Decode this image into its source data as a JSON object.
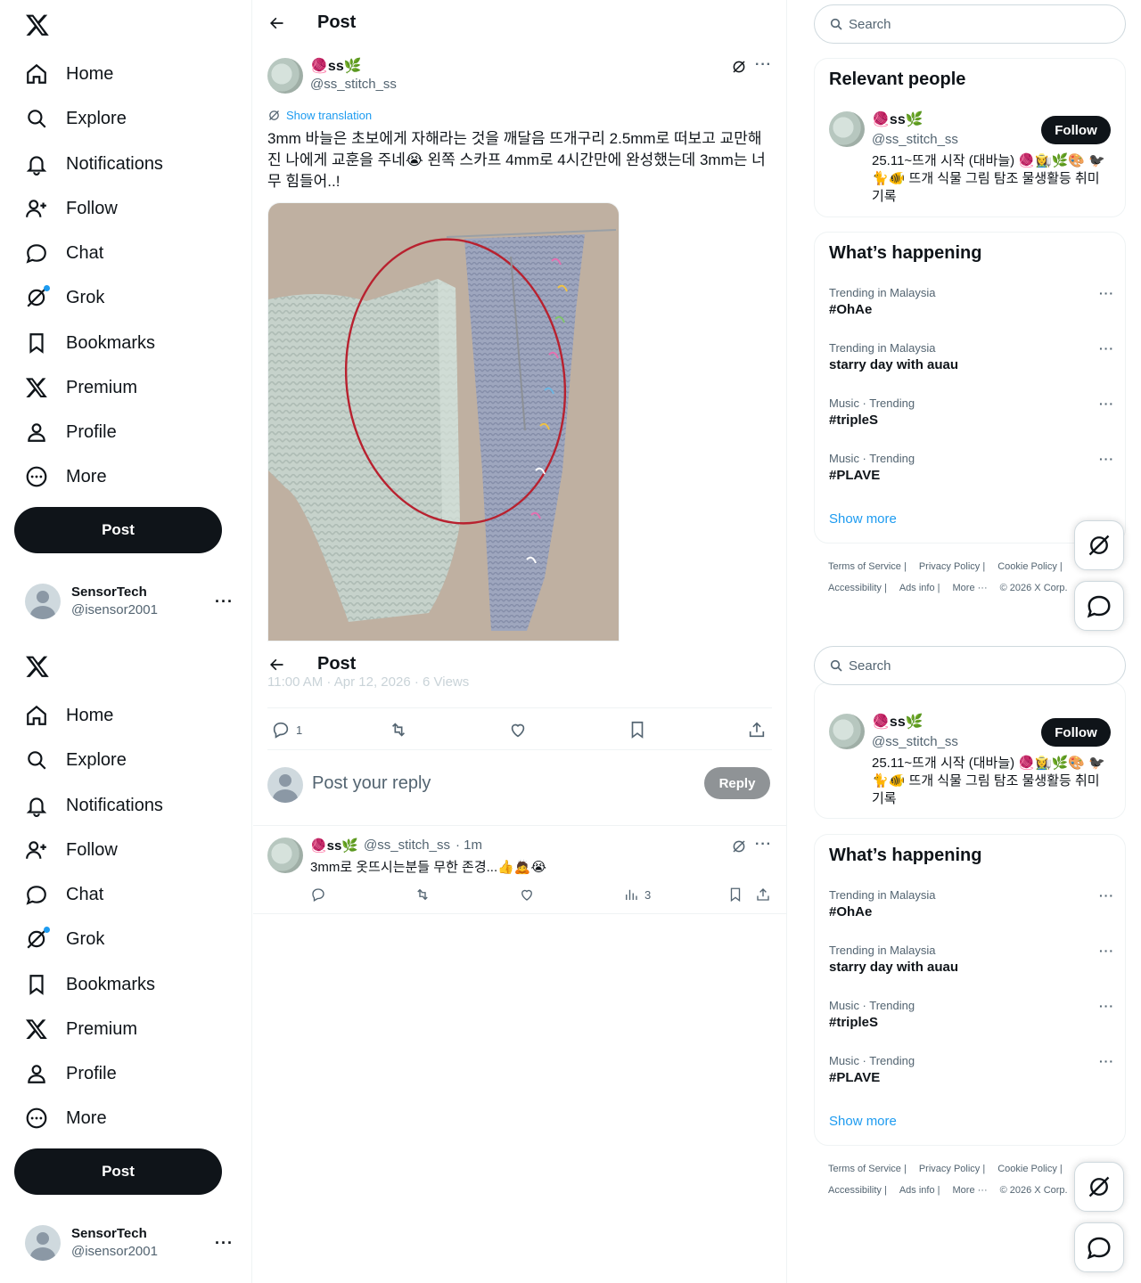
{
  "nav": {
    "items": [
      {
        "label": "Home",
        "icon": "home-icon"
      },
      {
        "label": "Explore",
        "icon": "search-icon"
      },
      {
        "label": "Notifications",
        "icon": "bell-icon"
      },
      {
        "label": "Follow",
        "icon": "add-person-icon"
      },
      {
        "label": "Chat",
        "icon": "chat-bubble-icon"
      },
      {
        "label": "Grok",
        "icon": "grok-icon"
      },
      {
        "label": "Bookmarks",
        "icon": "bookmark-icon"
      },
      {
        "label": "Premium",
        "icon": "x-logo-icon"
      },
      {
        "label": "Profile",
        "icon": "person-icon"
      },
      {
        "label": "More",
        "icon": "more-circle-icon"
      }
    ],
    "post_label": "Post"
  },
  "account": {
    "name": "SensorTech",
    "handle": "@isensor2001"
  },
  "topbar": {
    "title": "Post"
  },
  "post": {
    "display_name": "🧶ss🌿",
    "handle": "@ss_stitch_ss",
    "translate": "Show translation",
    "text": "3mm 바늘은 초보에게 자해라는 것을 깨달음 뜨개구리 2.5mm로 떠보고 교만해진 나에게 교훈을 주네😭 왼쪽 스카프 4mm로 4시간만에 완성했는데 3mm는 너무 힘들어..!",
    "meta": "11:00 AM · Apr 12, 2026 · 6 Views",
    "reply_count": "1"
  },
  "reply_box": {
    "placeholder": "Post your reply",
    "button": "Reply"
  },
  "comment": {
    "display_name": "🧶ss🌿",
    "handle": "@ss_stitch_ss",
    "time": "· 1m",
    "text": "3mm로 옷뜨시는분들 무한 존경...👍🙇😭",
    "views": "3"
  },
  "search": {
    "placeholder": "Search"
  },
  "relevant": {
    "title": "Relevant people",
    "name": "🧶ss🌿",
    "handle": "@ss_stitch_ss",
    "follow": "Follow",
    "bio": "25.11~뜨개 시작 (대바늘) 🧶👩‍🌾🌿🎨 🐦‍⬛🐈🐠 뜨개 식물 그림 탐조 물생활등 취미 기록"
  },
  "happening": {
    "title": "What’s happening",
    "trends": [
      {
        "context": "Trending in Malaysia",
        "topic": "#OhAe"
      },
      {
        "context": "Trending in Malaysia",
        "topic": "starry day with auau"
      },
      {
        "context": "Music · Trending",
        "topic": "#tripleS"
      },
      {
        "context": "Music · Trending",
        "topic": "#PLAVE"
      }
    ],
    "show_more": "Show more"
  },
  "footer": {
    "links": [
      "Terms of Service |",
      "Privacy Policy |",
      "Cookie Policy |"
    ],
    "links2": [
      "Accessibility |",
      "Ads info |",
      "More ···",
      "© 2026 X Corp."
    ]
  },
  "colors": {
    "accent": "#1d9bf0",
    "text": "#0f1419",
    "muted": "#536471"
  }
}
